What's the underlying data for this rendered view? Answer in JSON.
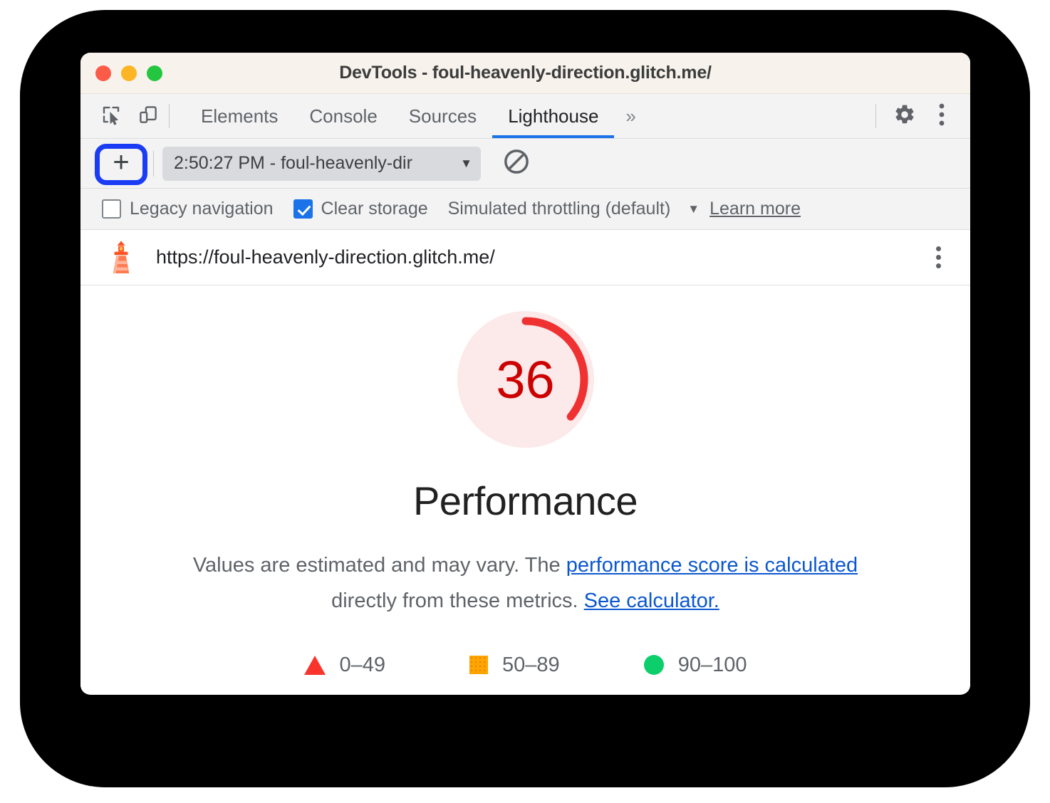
{
  "window": {
    "title": "DevTools - foul-heavenly-direction.glitch.me/",
    "traffic_lights": [
      "close",
      "minimize",
      "maximize"
    ]
  },
  "tabstrip": {
    "tool_icons": [
      "inspect-element-icon",
      "device-toolbar-icon"
    ],
    "tabs": [
      {
        "label": "Elements",
        "active": false
      },
      {
        "label": "Console",
        "active": false
      },
      {
        "label": "Sources",
        "active": false
      },
      {
        "label": "Lighthouse",
        "active": true
      }
    ],
    "more_tabs": "»",
    "settings_icon": "gear-icon",
    "menu_icon": "kebab-menu-icon"
  },
  "run_toolbar": {
    "add_label": "+",
    "report_select_value": "2:50:27 PM - foul-heavenly-dir",
    "report_select_caret": "▼",
    "clear_icon": "no-entry-icon"
  },
  "settings": {
    "legacy_navigation": {
      "label": "Legacy navigation",
      "checked": false
    },
    "clear_storage": {
      "label": "Clear storage",
      "checked": true
    },
    "throttling": {
      "label": "Simulated throttling (default)",
      "caret": "▼"
    },
    "learn_more": "Learn more"
  },
  "url_header": {
    "icon": "lighthouse-icon",
    "url": "https://foul-heavenly-direction.glitch.me/",
    "menu_icon": "kebab-menu-icon"
  },
  "report": {
    "category_title": "Performance",
    "disclaimer_prefix": "Values are estimated and may vary. The ",
    "disclaimer_link1": "performance score is calculated",
    "disclaimer_middle": " directly from these metrics. ",
    "disclaimer_link2": "See calculator.",
    "legend": [
      {
        "swatch": "triangle",
        "label": "0–49",
        "color": "#f8342c"
      },
      {
        "swatch": "square",
        "label": "50–89",
        "color": "#ffa400"
      },
      {
        "swatch": "circle",
        "label": "90–100",
        "color": "#0cce6b"
      }
    ]
  },
  "chart_data": {
    "type": "pie",
    "title": "Performance",
    "score": 36,
    "score_label": "36",
    "max": 100,
    "arc_fraction": 0.36,
    "arc_color": "#f03131",
    "track_color": "#fce9e9",
    "value_color": "#cc0000",
    "legend_bands": [
      {
        "range": "0–49",
        "color": "#f8342c"
      },
      {
        "range": "50–89",
        "color": "#ffa400"
      },
      {
        "range": "90–100",
        "color": "#0cce6b"
      }
    ]
  }
}
